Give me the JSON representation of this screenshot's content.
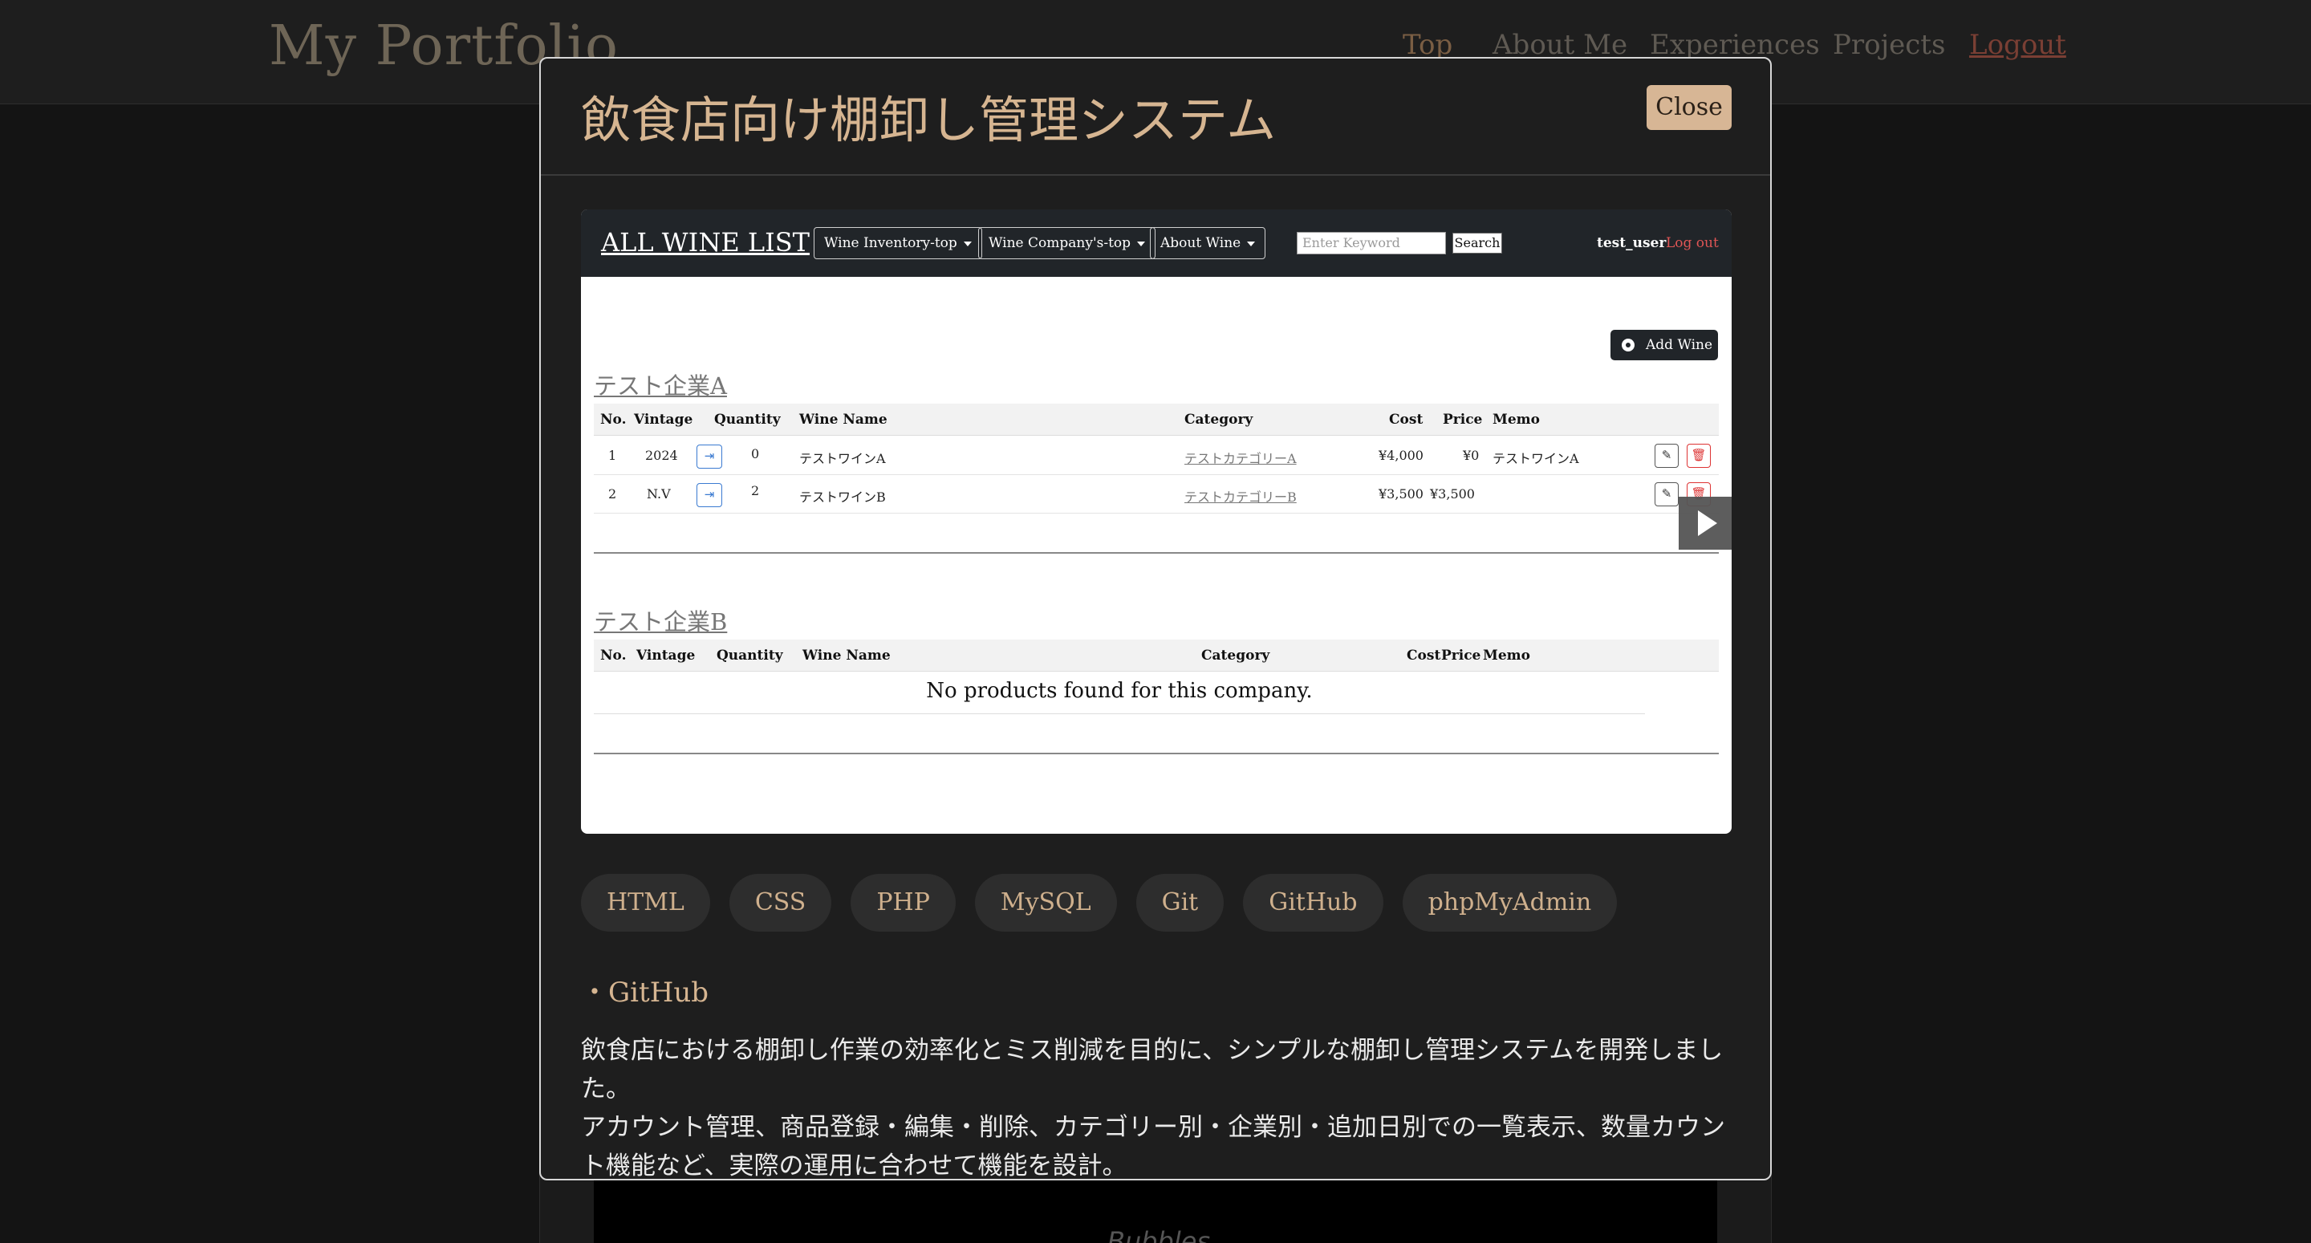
{
  "background": {
    "brand": "My Portfolio",
    "nav": [
      "Top",
      "About Me",
      "Experiences",
      "Projects",
      "Logout"
    ],
    "card_text": "Bubbles"
  },
  "modal": {
    "title": "飲食店向け棚卸し管理システム",
    "close_label": "Close",
    "screenshot": {
      "brand": "ALL WINE LIST",
      "menus": [
        "Wine Inventory-top",
        "Wine Company's-top",
        "About Wine"
      ],
      "search_placeholder": "Enter Keyword",
      "search_label": "Search",
      "user": "test_user",
      "logout": "Log out",
      "add_wine": "Add Wine",
      "headers": [
        "No.",
        "Vintage",
        "Quantity",
        "Wine Name",
        "Category",
        "Cost",
        "Price",
        "Memo"
      ],
      "companies": [
        {
          "name": "テスト企業A",
          "rows": [
            {
              "no": "1",
              "vintage": "2024",
              "quantity": "0",
              "name": "テストワインA",
              "category": "テストカテゴリーA",
              "cost": "¥4,000",
              "price": "¥0",
              "memo": "テストワインA"
            },
            {
              "no": "2",
              "vintage": "N.V",
              "quantity": "2",
              "name": "テストワインB",
              "category": "テストカテゴリーB",
              "cost": "¥3,500",
              "price": "¥3,500",
              "memo": ""
            }
          ]
        },
        {
          "name": "テスト企業B",
          "empty": "No products found for this company."
        }
      ]
    },
    "tags": [
      "HTML",
      "CSS",
      "PHP",
      "MySQL",
      "Git",
      "GitHub",
      "phpMyAdmin"
    ],
    "github_link": "・GitHub",
    "description": [
      "飲食店における棚卸し作業の効率化とミス削減を目的に、シンプルな棚卸し管理システムを開発しました。",
      "アカウント管理、商品登録・編集・削除、カテゴリー別・企業別・追加日別での一覧表示、数量カウント機能など、実際の運用に合わせて機能を設計。"
    ]
  }
}
